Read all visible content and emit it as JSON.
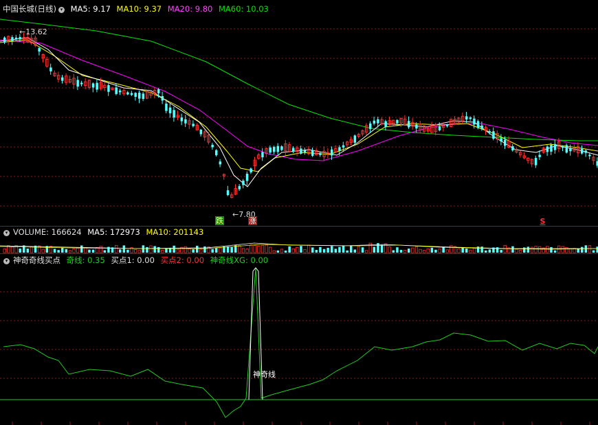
{
  "main_header": {
    "title": "中国长城(日线)",
    "ma5": "MA5: 9.17",
    "ma10": "MA10: 9.37",
    "ma20": "MA20: 9.80",
    "ma60": "MA60: 10.03"
  },
  "main_annotations": {
    "high_label": "13.62",
    "low_label": "7.80",
    "signal_fall": "跌",
    "signal_rise": "涨",
    "signal_sell": "S"
  },
  "volume_header": {
    "volume": "VOLUME: 166624",
    "ma5": "MA5: 172973",
    "ma10": "MA10: 201143"
  },
  "indicator_header": {
    "name": "神奇奇线买点",
    "qixian": "奇线: 0.35",
    "buy1": "买点1: 0.00",
    "buy2": "买点2: 0.00",
    "xg": "神奇线XG: 0.00"
  },
  "indicator_annotations": {
    "line_label": "神奇线"
  },
  "colors": {
    "background": "#000000",
    "up": "#ff3232",
    "down": "#54ffff",
    "ma5": "#ffffff",
    "ma10": "#ffff00",
    "ma20": "#ff00ff",
    "ma60": "#00e600",
    "indicator": "#22cc22",
    "separator": "#8a1a1a"
  }
}
